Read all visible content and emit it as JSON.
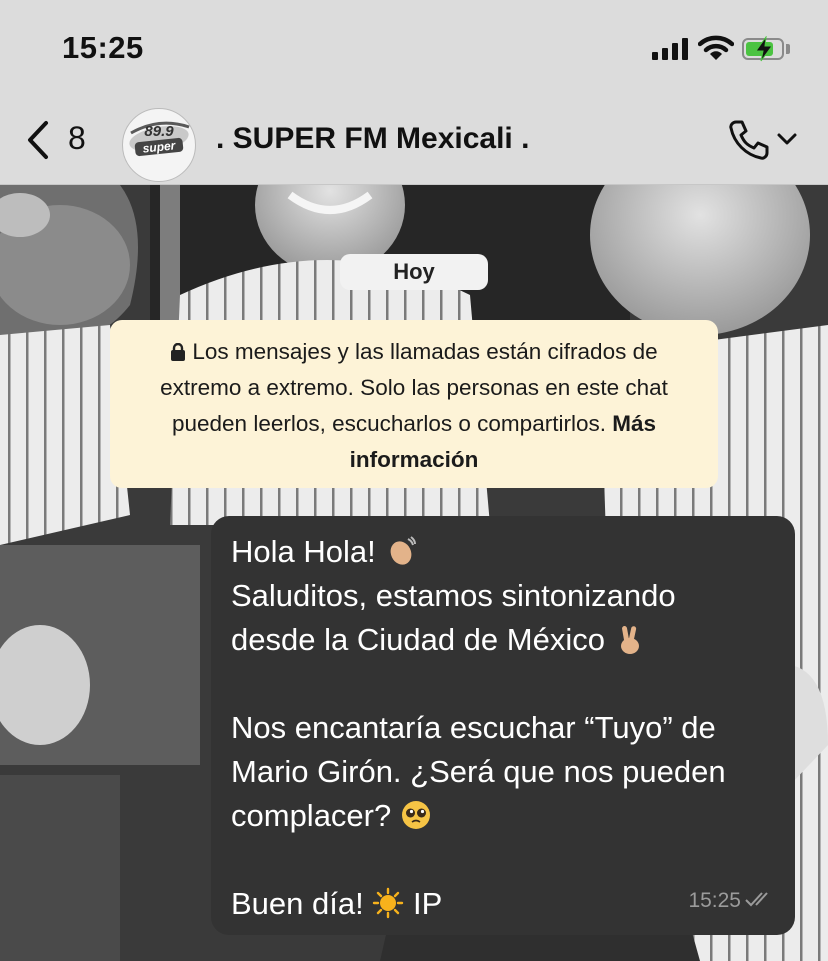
{
  "status_bar": {
    "time": "15:25"
  },
  "header": {
    "back_count": "8",
    "avatar_text": "89.9 super",
    "title": ". SUPER FM Mexicali ."
  },
  "chat": {
    "date_label": "Hoy",
    "encryption": {
      "text": "Los mensajes y las llamadas están cifrados de extremo a extremo. Solo las personas en este chat pueden leerlos, escucharlos o compartirlos.",
      "link": "Más información"
    },
    "message": {
      "lines": {
        "l1": "Hola Hola!",
        "l2": "Saluditos, estamos sintonizando",
        "l3": "desde la Ciudad de México",
        "l4": "Nos encantaría escuchar “Tuyo” de",
        "l5": "Mario Girón. ¿Será que nos pueden",
        "l6": "complacer?",
        "l7": "Buen día!",
        "l7b": "IP"
      },
      "time": "15:25",
      "status": "read"
    }
  },
  "colors": {
    "bar_bg": "#dcdcdc",
    "bubble_bg": "#333333",
    "encryption_bg": "#fdf3d7",
    "battery_green": "#4bc341"
  }
}
